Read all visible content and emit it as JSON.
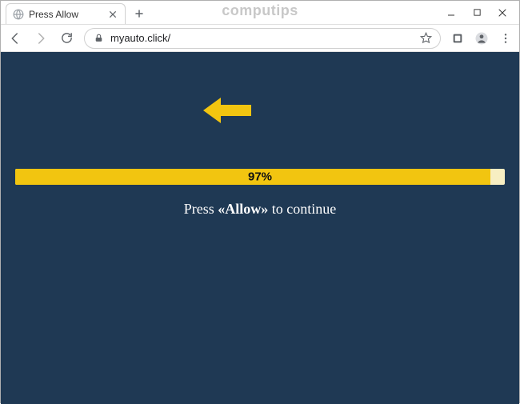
{
  "window": {
    "watermark": "computips"
  },
  "tab": {
    "title": "Press Allow"
  },
  "address": {
    "url": "myauto.click/"
  },
  "page": {
    "progress_percent": 97,
    "progress_label": "97%",
    "message_pre": "Press ",
    "message_strong": "«Allow»",
    "message_post": " to continue"
  }
}
